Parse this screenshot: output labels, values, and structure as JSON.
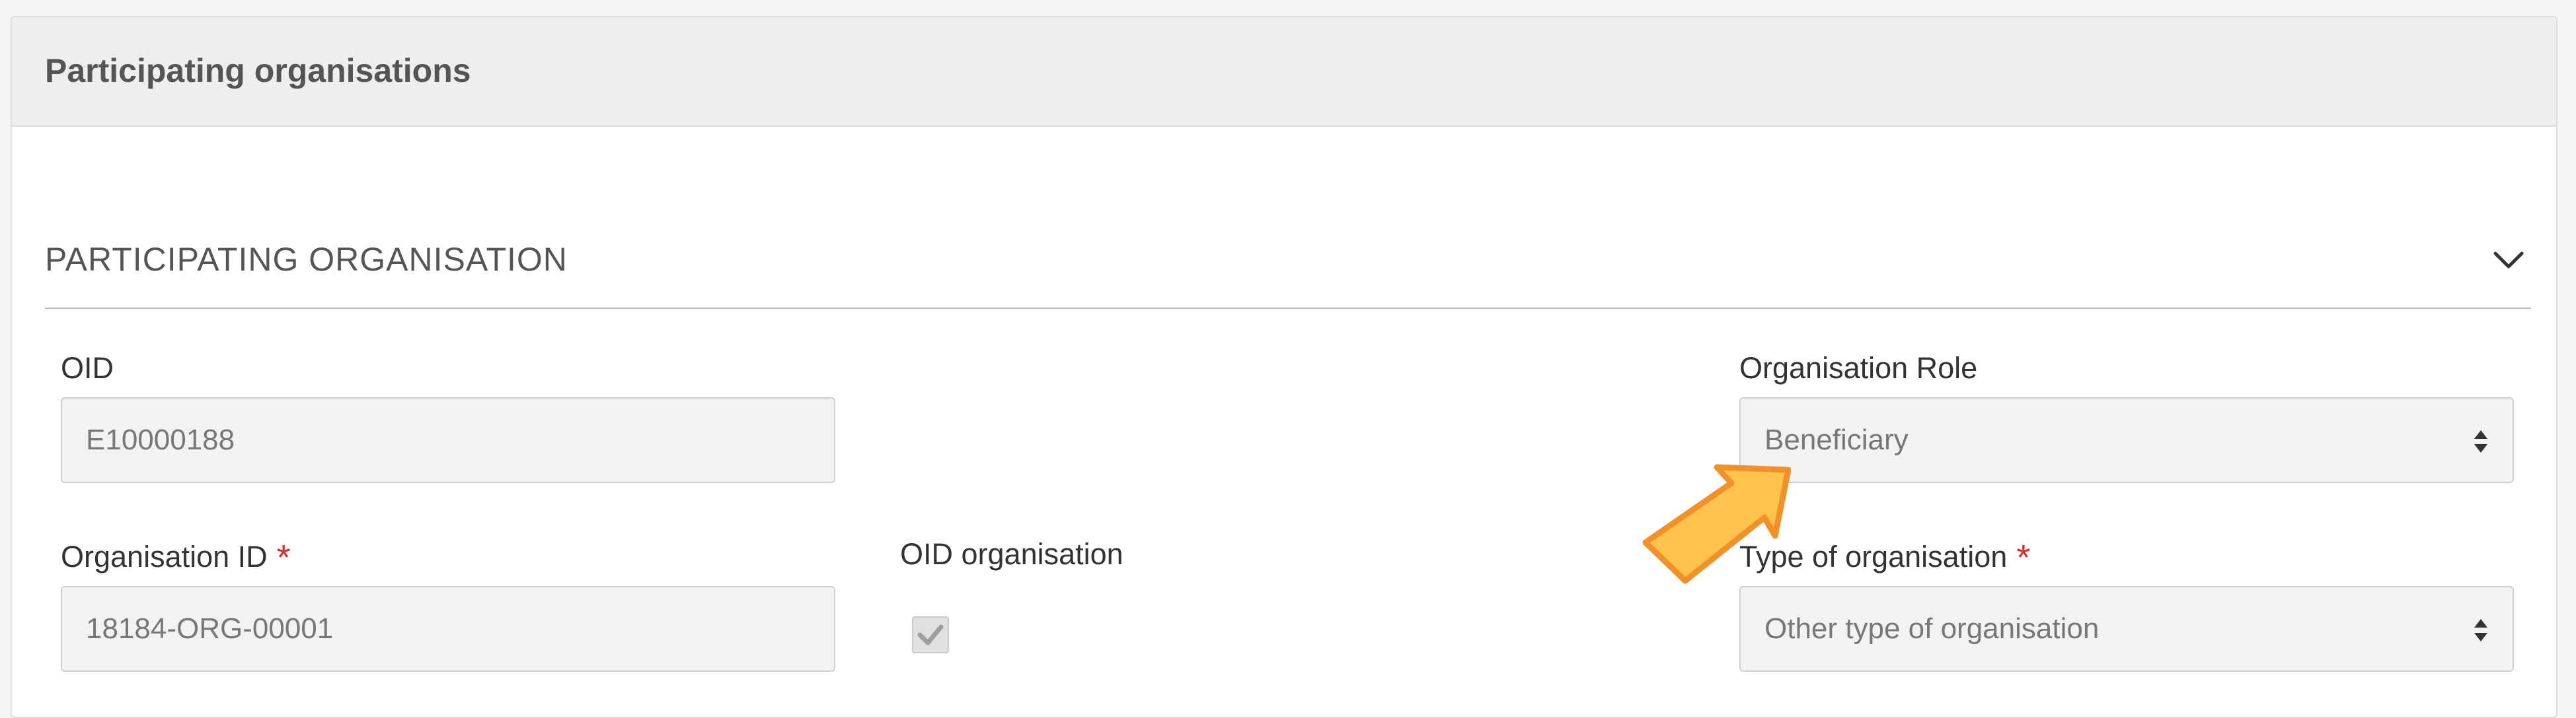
{
  "card": {
    "title": "Participating organisations"
  },
  "section": {
    "title": "PARTICIPATING ORGANISATION",
    "toggle_icon": "chevron-down-icon"
  },
  "fields": {
    "oid": {
      "label": "OID",
      "value": "E10000188"
    },
    "organisation_role": {
      "label": "Organisation Role",
      "value": "Beneficiary"
    },
    "organisation_id": {
      "label": "Organisation ID",
      "required_mark": "*",
      "value": "18184-ORG-00001"
    },
    "oid_organisation": {
      "label": "OID organisation",
      "checked": true
    },
    "type_of_organisation": {
      "label": "Type of organisation",
      "required_mark": "*",
      "value": "Other type of organisation"
    }
  },
  "annotation": {
    "icon": "pointer-arrow-icon",
    "color": "#ffc34d"
  },
  "colors": {
    "required": "#d32f2f",
    "header_bg": "#eeeeee",
    "field_bg": "#f2f2f2"
  }
}
